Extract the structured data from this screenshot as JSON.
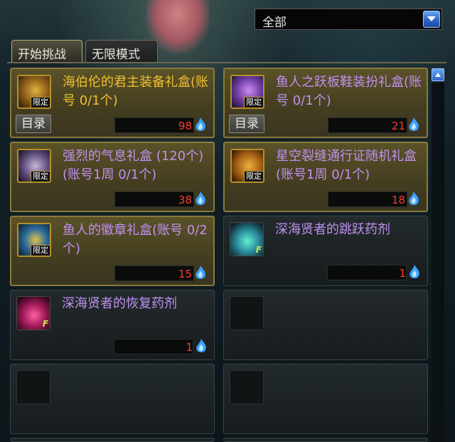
{
  "dropdown": {
    "selected": "全部"
  },
  "tabs": [
    {
      "label": "开始挑战",
      "active": true
    },
    {
      "label": "无限模式",
      "active": false
    }
  ],
  "colors": {
    "limited_border": "#8b7a3c",
    "gold_text": "#f0c030",
    "purple_text": "#c090f0",
    "count_red": "#ff3a2a"
  },
  "items": [
    {
      "name": "海伯伦的君主装备礼盒(账号 0/1个)",
      "badge": "限定",
      "button": "目录",
      "count": "98",
      "icon": "gold-gift-box-icon"
    },
    {
      "name": "鱼人之跃板鞋装扮礼盒(账号 0/1个)",
      "badge": "限定",
      "button": "目录",
      "count": "21",
      "icon": "purple-gift-box-icon"
    },
    {
      "name": "强烈的气息礼盒 (120个)(账号1周 0/1个)",
      "badge": "限定",
      "count": "38",
      "icon": "purple-pouch-icon"
    },
    {
      "name": "星空裂缝通行证随机礼盒(账号1周 0/1个)",
      "badge": "限定",
      "count": "18",
      "icon": "orange-pouch-icon"
    },
    {
      "name": "鱼人的徽章礼盒(账号 0/2个)",
      "badge": "限定",
      "count": "15",
      "icon": "winged-emblem-icon"
    },
    {
      "name": "深海贤者的跳跃药剂",
      "badge": "F",
      "count": "1",
      "icon": "cyan-potion-icon"
    },
    {
      "name": "深海贤者的恢复药剂",
      "badge": "F",
      "count": "1",
      "icon": "pink-potion-icon"
    }
  ]
}
